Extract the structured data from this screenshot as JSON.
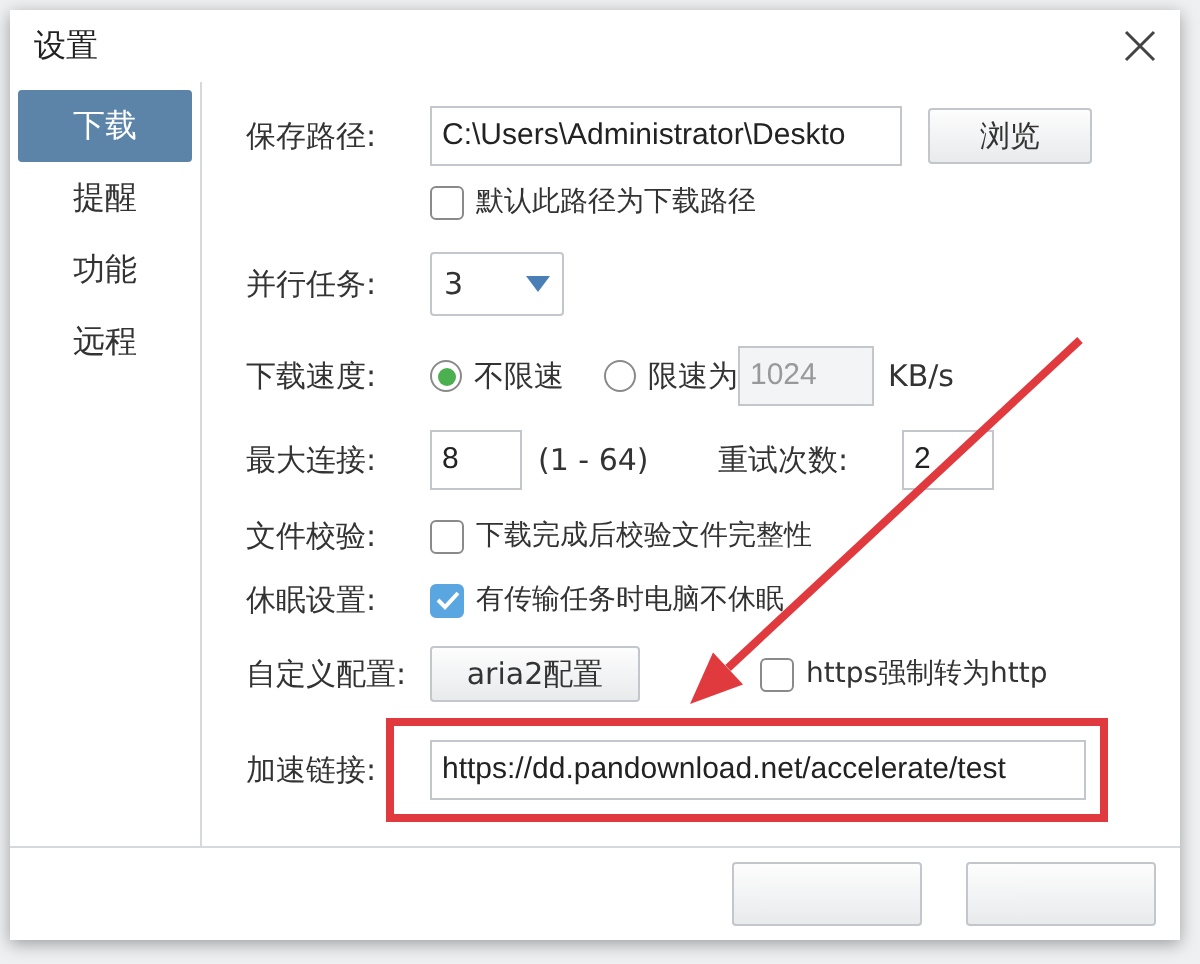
{
  "window": {
    "title": "设置"
  },
  "tabs": [
    {
      "label": "下载",
      "selected": true
    },
    {
      "label": "提醒",
      "selected": false
    },
    {
      "label": "功能",
      "selected": false
    },
    {
      "label": "远程",
      "selected": false
    }
  ],
  "save_path": {
    "label": "保存路径:",
    "value": "C:\\Users\\Administrator\\Deskto",
    "browse_button": "浏览",
    "default_checkbox": {
      "label": "默认此路径为下载路径",
      "checked": false
    }
  },
  "parallel_tasks": {
    "label": "并行任务:",
    "value": "3"
  },
  "download_speed": {
    "label": "下载速度:",
    "options": [
      {
        "label": "不限速",
        "selected": true
      },
      {
        "label": "限速为",
        "selected": false
      }
    ],
    "limit_value": "1024",
    "unit": "KB/s"
  },
  "max_connections": {
    "label": "最大连接:",
    "value": "8",
    "range": "(1 - 64)",
    "retry_label": "重试次数:",
    "retry_value": "2"
  },
  "file_check": {
    "label": "文件校验:",
    "checkbox": {
      "label": "下载完成后校验文件完整性",
      "checked": false
    }
  },
  "sleep": {
    "label": "休眠设置:",
    "checkbox": {
      "label": "有传输任务时电脑不休眠",
      "checked": true
    }
  },
  "custom_config": {
    "label": "自定义配置:",
    "button": "aria2配置",
    "checkbox": {
      "label": "https强制转为http",
      "checked": false
    }
  },
  "accelerate_link": {
    "label": "加速链接:",
    "value": "https://dd.pandownload.net/accelerate/test",
    "highlighted": true
  }
}
